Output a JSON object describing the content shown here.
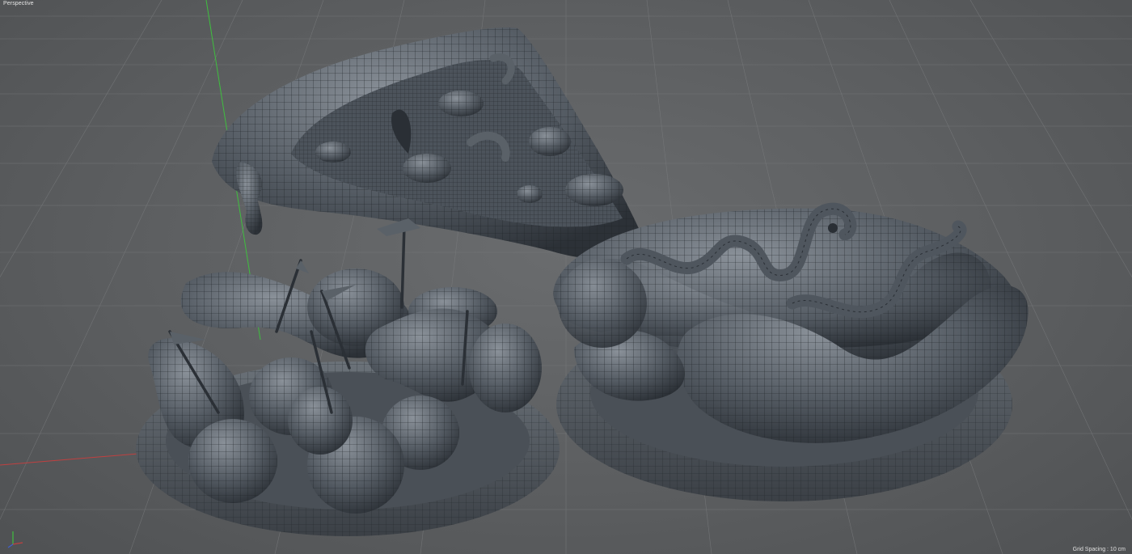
{
  "viewport": {
    "view_name": "Perspective",
    "grid_spacing_text": "Grid Spacing : 10 cm"
  },
  "colors": {
    "background": "#5f6163",
    "grid_line": "#767879",
    "axis_green": "#3fbf3f",
    "axis_red": "#c04040",
    "mesh_fill": "#4a5058",
    "mesh_wire": "#1c1f23"
  },
  "scene_objects": [
    "pizza-slice-mesh",
    "fruit-plate-mesh",
    "hotdog-plate-mesh"
  ],
  "icons": [
    "axis-gizmo-icon"
  ]
}
